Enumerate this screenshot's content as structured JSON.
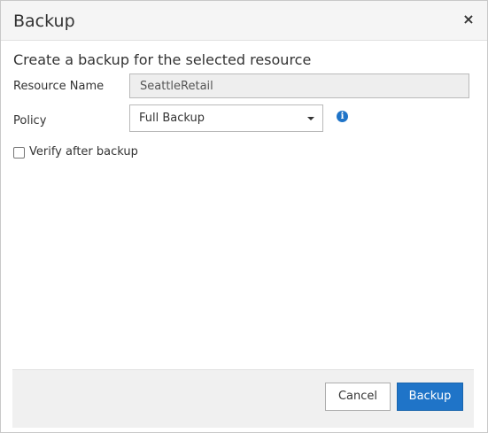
{
  "dialog": {
    "title": "Backup",
    "close_icon": "close-icon",
    "close_glyph": "×"
  },
  "form": {
    "subtitle": "Create a backup for the selected resource",
    "resource_name_label": "Resource Name",
    "resource_name_value": "SeattleRetail",
    "policy_label": "Policy",
    "policy_selected": "Full Backup",
    "info_icon": "info-icon",
    "verify_label": "Verify after backup",
    "verify_checked": false
  },
  "footer": {
    "cancel_label": "Cancel",
    "backup_label": "Backup"
  },
  "colors": {
    "primary": "#1f74c8",
    "header_bg": "#f5f5f5",
    "footer_bg": "#f0f0f0",
    "disabled_input_bg": "#eeeeee"
  }
}
